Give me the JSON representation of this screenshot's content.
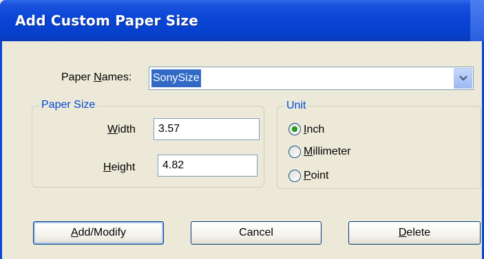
{
  "window": {
    "title": "Add Custom Paper Size"
  },
  "paper_names": {
    "label_pre": "Paper ",
    "label_key": "N",
    "label_post": "ames:",
    "value": "SonySize"
  },
  "paper_size": {
    "legend": "Paper Size",
    "width": {
      "label_key": "W",
      "label_post": "idth",
      "value": "3.57"
    },
    "height": {
      "label_key": "H",
      "label_post": "eight",
      "value": "4.82"
    }
  },
  "unit": {
    "legend": "Unit",
    "selected": "Inch",
    "options": [
      {
        "key": "I",
        "post": "nch"
      },
      {
        "key": "M",
        "post": "illimeter"
      },
      {
        "key": "P",
        "post": "oint"
      }
    ]
  },
  "buttons": {
    "add_modify": {
      "key": "A",
      "post": "dd/Modify"
    },
    "cancel": {
      "label": "Cancel"
    },
    "delete": {
      "key": "D",
      "post": "elete"
    }
  }
}
